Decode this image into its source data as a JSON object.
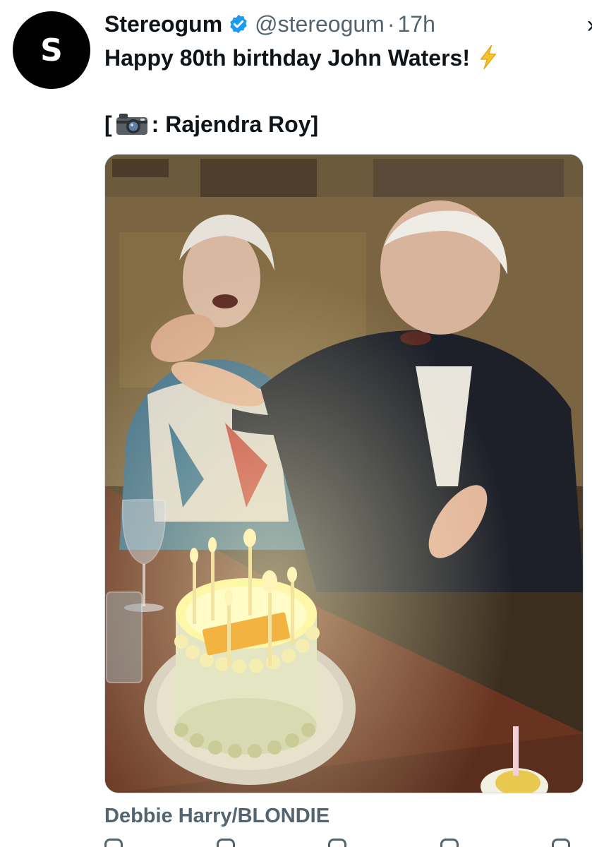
{
  "tweet": {
    "avatar_letter": "S",
    "author_name": "Stereogum",
    "handle": "@stereogum",
    "separator": "·",
    "time": "17h",
    "text": "Happy 80th birthday John Waters!",
    "credit_open": "[",
    "credit_rest": ": Rajendra Roy]",
    "media_caption": "Debbie Harry/BLONDIE"
  },
  "icons": {
    "verified": "verified-badge-icon",
    "bolt": "lightning-bolt-emoji",
    "camera": "camera-emoji",
    "more": "chevron-icon"
  },
  "colors": {
    "verified_blue": "#1d9bf0",
    "bolt_yellow": "#f7c32b",
    "secondary_text": "#536471"
  }
}
